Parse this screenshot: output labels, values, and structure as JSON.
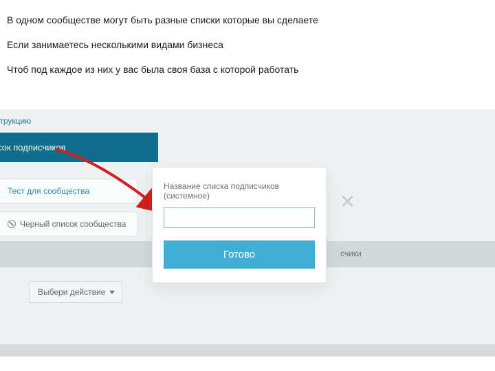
{
  "intro": {
    "line1": "В одном сообществе могут быть разные списки которые вы сделаете",
    "line2": "Если занимаетесь несколькими видами бизнеса",
    "line3": "Чтоб под каждое из них у вас была своя база с которой работать"
  },
  "app": {
    "instruction_link": "инструкцию",
    "create_list_button": "ать список подписчиков",
    "sidebar": {
      "test_item": "Тест для сообщества",
      "blacklist_item": "Черный список сообщества"
    },
    "gray_band_text": "счики",
    "close_x": "×",
    "action_select": "Выбери действие"
  },
  "modal": {
    "label": "Название списка подписчиков (системное)",
    "input_value": "",
    "submit_label": "Готово"
  },
  "colors": {
    "accent_button": "#3eaed3",
    "header_button": "#106d8c",
    "link": "#267a99",
    "arrow": "#d21f1f"
  }
}
